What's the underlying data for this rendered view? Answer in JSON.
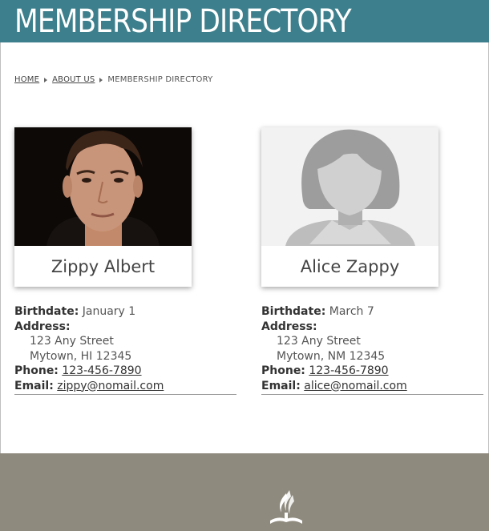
{
  "header": {
    "title": "MEMBERSHIP DIRECTORY"
  },
  "breadcrumb": {
    "home": "HOME",
    "about": "ABOUT US",
    "current": "MEMBERSHIP DIRECTORY"
  },
  "members": [
    {
      "name": "Zippy Albert",
      "birthdate_label": "Birthdate:",
      "birthdate": "January 1",
      "address_label": "Address:",
      "address_line1": "123 Any Street",
      "address_line2": "Mytown, HI 12345",
      "phone_label": "Phone:",
      "phone": "123-456-7890",
      "email_label": "Email:",
      "email": "zippy@nomail.com"
    },
    {
      "name": "Alice Zappy",
      "birthdate_label": "Birthdate:",
      "birthdate": "March 7",
      "address_label": "Address:",
      "address_line1": "123 Any Street",
      "address_line2": "Mytown, NM 12345",
      "phone_label": "Phone:",
      "phone": "123-456-7890",
      "email_label": "Email:",
      "email": "alice@nomail.com"
    }
  ],
  "colors": {
    "header": "#3d7f8c",
    "footer": "#8f8a7e"
  },
  "icons": {
    "footer_logo": "church-logo-icon",
    "crumb_separator": "caret-right-icon"
  }
}
